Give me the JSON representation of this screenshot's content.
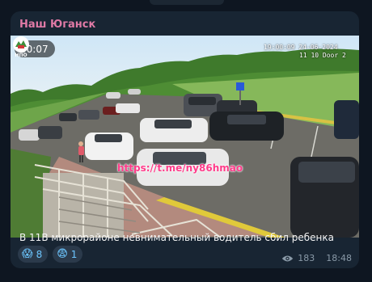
{
  "channel": {
    "name": "Наш Юганск"
  },
  "video": {
    "duration": "00:07",
    "muted_icon": "speaker-muted-icon",
    "cam_datetime": "19:00:09  24-06-2024",
    "cam_label": "11 10 Door 2",
    "logo_text": "НПО",
    "watermark": "https://t.me/ny86hmao"
  },
  "post": {
    "caption": "В 11В микрорайоне невнимательный водитель сбил ребенка",
    "reactions": [
      {
        "emoji": "😱",
        "count": "8"
      },
      {
        "emoji": "😨",
        "count": "1"
      }
    ],
    "views": "183",
    "time": "18:48"
  },
  "colors": {
    "background": "#0e1621",
    "bubble": "#182533",
    "channel_name": "#e07aa6",
    "reaction_bg": "#2b3a4b",
    "reaction_count": "#6cc6ff",
    "meta": "#8a9aa8",
    "watermark": "#ff3c8a"
  }
}
